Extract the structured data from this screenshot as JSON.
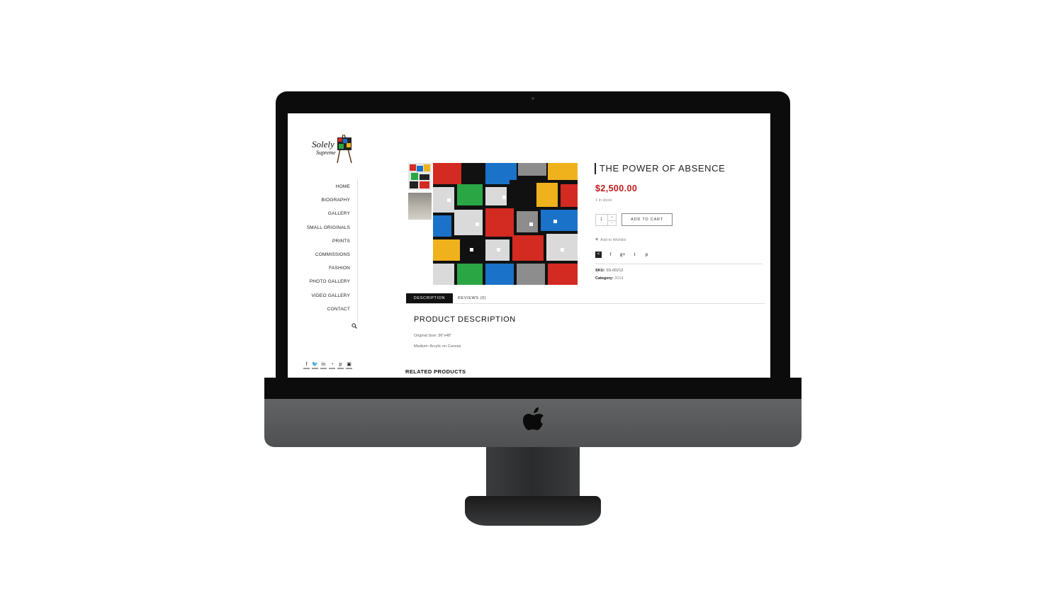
{
  "site": {
    "logo_text": "Solely Supreme",
    "nav": [
      "HOME",
      "BIOGRAPHY",
      "GALLERY",
      "SMALL ORIGINALS",
      "PRINTS",
      "COMMISSIONS",
      "FASHION",
      "PHOTO GALLERY",
      "VIDEO GALLERY",
      "CONTACT"
    ],
    "social": [
      "f",
      "t",
      "in",
      "rss",
      "p",
      "ig"
    ]
  },
  "product": {
    "title": "THE POWER OF ABSENCE",
    "price": "$2,500.00",
    "stock": "1 in stock",
    "quantity": "1",
    "add_to_cart": "ADD TO CART",
    "wishlist": "Add to Wishlist",
    "share": [
      "f",
      "g+",
      "t",
      "p"
    ],
    "sku_label": "SKU:",
    "sku": "SS-00212",
    "category_label": "Category:",
    "category": "2014",
    "price_color": "#c0191b"
  },
  "tabs": {
    "description": "DESCRIPTION",
    "reviews": "REVIEWS (0)"
  },
  "description": {
    "title": "PRODUCT DESCRIPTION",
    "size": "Original Size: 36\"x48\"",
    "medium": "Medium: Acrylic on Canvas"
  },
  "related_title": "RELATED PRODUCTS"
}
